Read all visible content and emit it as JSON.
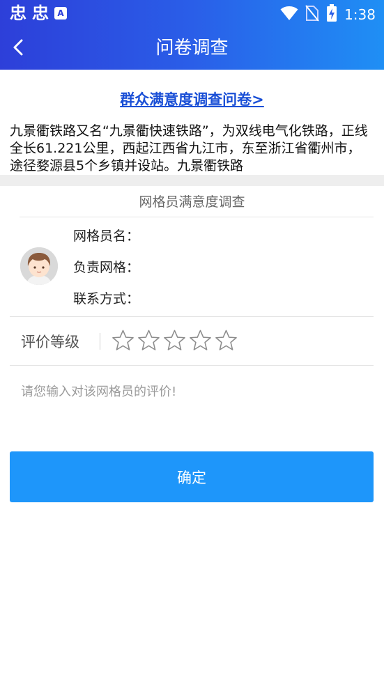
{
  "status_bar": {
    "left_glyphs": [
      "忠",
      "忠"
    ],
    "badge": "A",
    "time": "1:38",
    "icons": [
      "wifi-icon",
      "no-sim-icon",
      "battery-charging-icon"
    ]
  },
  "header": {
    "title": "问卷调查",
    "back_icon": "chevron-left-icon"
  },
  "intro": {
    "link_text": "群众满意度调查问卷>",
    "text": "九景衢铁路又名“九景衢快速铁路”，为双线电气化铁路，正线全长61.221公里，西起江西省九江市，东至浙江省衢州市，途径婺源县5个乡镇并设站。九景衢铁路"
  },
  "survey": {
    "section_title": "网格员满意度调查",
    "fields": {
      "name": "网格员名：",
      "grid": "负责网格：",
      "contact": "联系方式："
    },
    "rating": {
      "label": "评价等级",
      "max": 5,
      "value": 0
    },
    "comment_placeholder": "请您输入对该网格员的评价!",
    "comment_value": ""
  },
  "actions": {
    "confirm_label": "确定"
  },
  "colors": {
    "header_start": "#2d3fd9",
    "header_end": "#1f8ff5",
    "link": "#1a4fd6",
    "button": "#1e96fa"
  }
}
